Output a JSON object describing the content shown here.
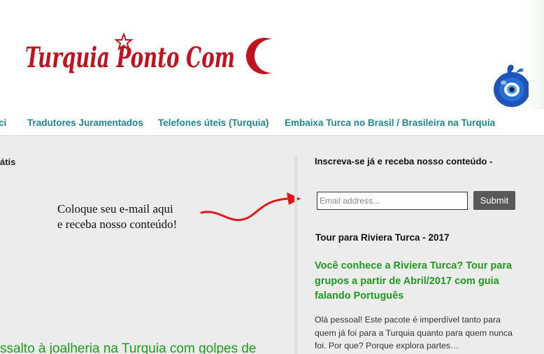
{
  "header": {
    "site_title": "Turquia Ponto Com",
    "colors": {
      "logo_red": "#c1121f",
      "nav_teal": "#20868e",
      "link_green": "#1e9a1e"
    },
    "icons": {
      "logo_star": "star-icon",
      "logo_crescent": "crescent-icon",
      "evil_eye": "evil-eye-icon"
    }
  },
  "nav": {
    "items": [
      {
        "label": "ci"
      },
      {
        "label": "Tradutores Juramentados"
      },
      {
        "label": "Telefones úteis (Turquia)"
      },
      {
        "label": "Embaixa Turca no Brasil / Brasileira na Turquia"
      }
    ]
  },
  "main": {
    "left_heading": "átis",
    "annotation_line1": "Coloque seu e-mail aqui",
    "annotation_line2": "e receba nosso conteúdo!",
    "partial_link": "ssalto à joalheria na Turquia com golpes de"
  },
  "sidebar": {
    "subscribe_title": "Inscreva-se já e receba nosso conteúdo -",
    "email_placeholder": "Email address...",
    "email_value": "",
    "submit_label": "Submit",
    "tour_heading": "Tour para Riviera Turca - 2017",
    "post_title": "Você conhece a Riviera Turca? Tour para grupos a partir de Abril/2017 com guia falando Português",
    "post_excerpt": "Olá pessoal! Este pacote é imperdível tanto para quem já foi para a Turquia quanto para quem nunca foi. Por que? Porque explora partes…"
  }
}
